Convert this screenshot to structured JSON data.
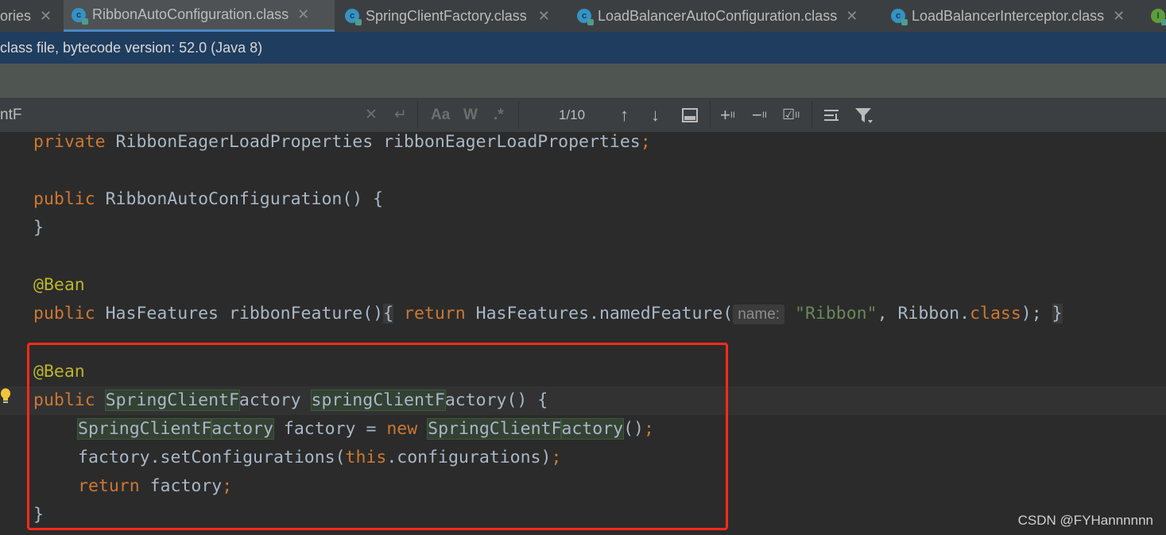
{
  "tabs": [
    {
      "label": "ories"
    },
    {
      "label": "RibbonAutoConfiguration.class"
    },
    {
      "label": "SpringClientFactory.class"
    },
    {
      "label": "LoadBalancerAutoConfiguration.class"
    },
    {
      "label": "LoadBalancerInterceptor.class"
    },
    {
      "icon_letter": "I"
    }
  ],
  "info_bar": {
    "text": "class file, bytecode version: 52.0 (Java 8)"
  },
  "find_bar": {
    "query": "ntF",
    "match_case": "Aa",
    "words": "W",
    "regex": ".*",
    "match_count": "1/10"
  },
  "code": {
    "l1": {
      "kw": "private",
      "rest": " RibbonEagerLoadProperties ribbonEagerLoadProperties",
      "semi": ";"
    },
    "l2": {
      "kw": "public",
      "rest": " RibbonAutoConfiguration() {"
    },
    "l3": {
      "text": "}"
    },
    "l4": {
      "text": "@Bean"
    },
    "l5": {
      "kw": "public",
      "a": " HasFeatures ribbonFeature()",
      "b": "{",
      "c": "return",
      "d": " HasFeatures.namedFeature(",
      "hint": "name:",
      "str": "\"Ribbon\"",
      "e": ", Ribbon.",
      "f": "class",
      "g": ");",
      "h": "}"
    },
    "l6": {
      "text": "@Bean"
    },
    "l7": {
      "kw": "public",
      "t1": "SpringClientF",
      "t2": "actory",
      "m1": "springClientF",
      "m2": "actory",
      "rest": "() {"
    },
    "l8": {
      "t1": "SpringClientF",
      "t2": "actory",
      "a": " factory = ",
      "kw": "new",
      "c1": "SpringClientF",
      "c2": "actory",
      "end": "()",
      "semi": ";"
    },
    "l9": {
      "a": "factory.setConfigurations(",
      "kw": "this",
      "b": ".configurations)",
      "semi": ";"
    },
    "l10": {
      "kw": "return",
      "a": " factory",
      "semi": ";"
    },
    "l11": {
      "text": "}"
    }
  },
  "watermark": "CSDN @FYHannnnnn"
}
